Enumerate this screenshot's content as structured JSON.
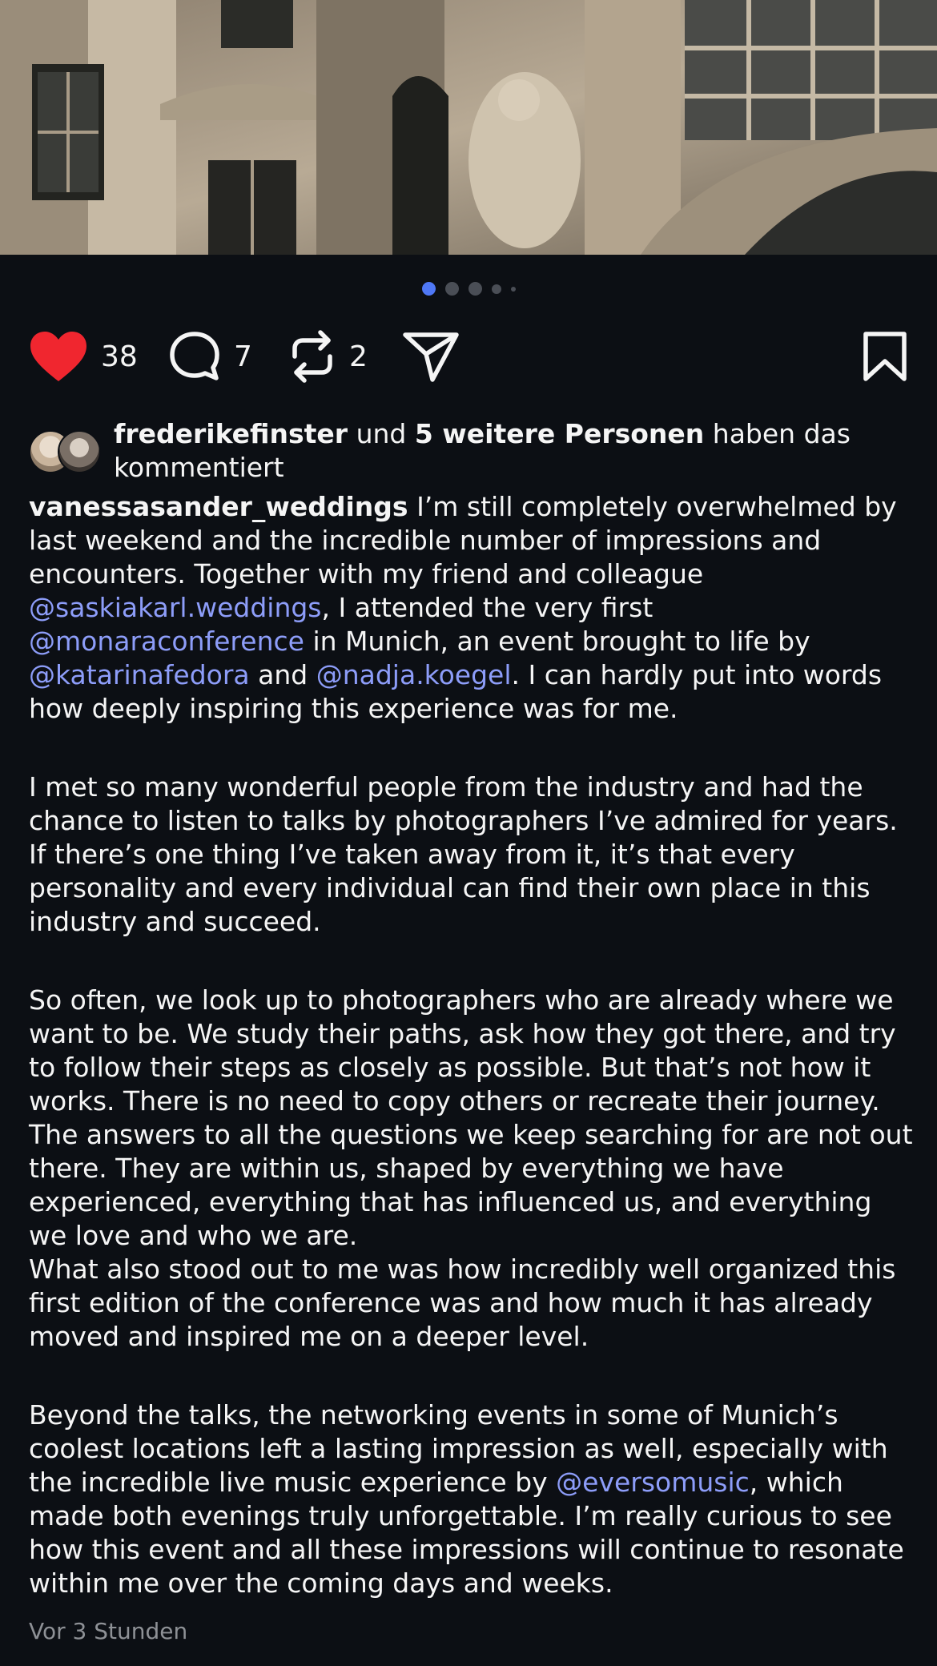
{
  "post": {
    "image": {
      "description_icon": "building-facade-photo"
    },
    "carousel": {
      "count": 5,
      "active_index": 0,
      "active_color": "#4f78f6"
    },
    "actions": {
      "likes": "38",
      "comments": "7",
      "reposts": "2"
    },
    "commenters": {
      "user": "frederikefinster",
      "connector": " und ",
      "others": "5 weitere Personen",
      "suffix": " haben das kommentiert"
    },
    "caption": {
      "author": "vanessasander_weddings",
      "p1_a": " I’m still completely overwhelmed by last weekend and the incredible number of impressions and encounters. Together with my friend and colleague ",
      "m1": "@saskiakarl.weddings",
      "p1_b": ", I attended the very first ",
      "m2": "@monaraconference",
      "p1_c": " in Munich, an event brought to life by ",
      "m3": "@katarinafedora",
      "p1_d": " and ",
      "m4": "@nadja.koegel",
      "p1_e": ". I can hardly put into words how deeply inspiring this experience was for me.",
      "p2": "I met so many wonderful people from the industry and had the chance to listen to talks by photographers I’ve admired for years. If there’s one thing I’ve taken away from it, it’s that every personality and every individual can find their own place in this industry and succeed.",
      "p3": "So often, we look up to photographers who are already where we want to be. We study their paths, ask how they got there, and try to follow their steps as closely as possible. But that’s not how it works. There is no need to copy others or recreate their journey. The answers to all the questions we keep searching for are not out there. They are within us, shaped by everything we have experienced, everything that has influenced us, and everything we love and who we are.",
      "p4": "What also stood out to me was how incredibly well organized this first edition of the conference was and how much it has already moved and inspired me on a deeper level.",
      "p5_a": "Beyond the talks, the networking events in some of Munich’s coolest locations left a lasting impression as well, especially with the incredible live music experience by ",
      "m5": "@eversomusic",
      "p5_b": ", which made both evenings truly unforgettable. I’m really curious to see how this event and all these impressions will continue to resonate within me over the coming days and weeks."
    },
    "timestamp": "Vor 3 Stunden",
    "colors": {
      "background": "#0c0f14",
      "mention": "#8d9df9",
      "like": "#f0262f"
    }
  }
}
